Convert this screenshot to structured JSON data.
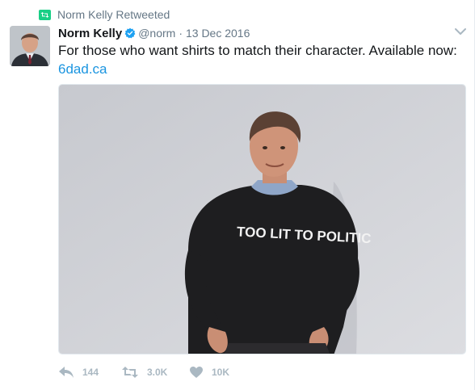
{
  "retweet_context": {
    "icon": "retweet-icon",
    "text": "Norm Kelly Retweeted",
    "color": "#19cf86"
  },
  "tweet": {
    "author": {
      "fullname": "Norm Kelly",
      "verified": true,
      "screenname": "@norm"
    },
    "separator": "·",
    "timestamp": "13 Dec 2016",
    "text": "For those who want shirts to match their character. Available now:",
    "link": "6dad.ca",
    "media": {
      "shirt_text": "TOO LIT TO POLITIC"
    },
    "actions": {
      "reply": {
        "icon": "reply-icon",
        "count": "144"
      },
      "retweet": {
        "icon": "retweet-icon",
        "count": "3.0K"
      },
      "like": {
        "icon": "heart-icon",
        "count": "10K"
      }
    }
  },
  "colors": {
    "link": "#1b95e0",
    "muted": "#657786",
    "action": "#aab8c2",
    "verified": "#1da1f2"
  }
}
